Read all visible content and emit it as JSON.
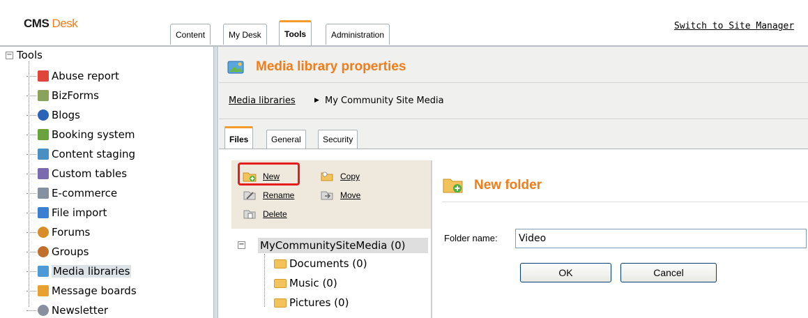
{
  "app": {
    "logo_part1": "CMS",
    "logo_part2": "Desk"
  },
  "header": {
    "tabs": [
      {
        "label": "Content",
        "selected": false
      },
      {
        "label": "My Desk",
        "selected": false
      },
      {
        "label": "Tools",
        "selected": true
      },
      {
        "label": "Administration",
        "selected": false
      }
    ],
    "switch_link": "Switch to Site Manager"
  },
  "sidebar": {
    "root": "Tools",
    "items": [
      {
        "label": "Abuse report",
        "icon": "abuse-report-icon",
        "color": "#e0443a"
      },
      {
        "label": "BizForms",
        "icon": "bizforms-icon",
        "color": "#8aa35a"
      },
      {
        "label": "Blogs",
        "icon": "blogs-icon",
        "color": "#2b63b8"
      },
      {
        "label": "Booking system",
        "icon": "booking-system-icon",
        "color": "#6aa33c"
      },
      {
        "label": "Content staging",
        "icon": "content-staging-icon",
        "color": "#4a8fc4"
      },
      {
        "label": "Custom tables",
        "icon": "custom-tables-icon",
        "color": "#7a6ab0"
      },
      {
        "label": "E-commerce",
        "icon": "ecommerce-icon",
        "color": "#8590a0"
      },
      {
        "label": "File import",
        "icon": "file-import-icon",
        "color": "#3a7fd0"
      },
      {
        "label": "Forums",
        "icon": "forums-icon",
        "color": "#d98c2a"
      },
      {
        "label": "Groups",
        "icon": "groups-icon",
        "color": "#c0702a"
      },
      {
        "label": "Media libraries",
        "icon": "media-libraries-icon",
        "color": "#4c9ad6",
        "selected": true
      },
      {
        "label": "Message boards",
        "icon": "message-boards-icon",
        "color": "#e8a030"
      },
      {
        "label": "Newsletter",
        "icon": "newsletter-icon",
        "color": "#8a8fa0"
      }
    ]
  },
  "main": {
    "title": "Media library properties",
    "breadcrumb": {
      "link": "Media libraries",
      "current": "My Community Site Media"
    },
    "tabs": [
      {
        "label": "Files",
        "selected": true
      },
      {
        "label": "General",
        "selected": false
      },
      {
        "label": "Security",
        "selected": false
      }
    ],
    "actions": {
      "new": "New",
      "copy": "Copy",
      "rename": "Rename",
      "move": "Move",
      "delete": "Delete"
    },
    "media_tree": {
      "root": "MyCommunitySiteMedia (0)",
      "folders": [
        "Documents (0)",
        "Music (0)",
        "Pictures (0)"
      ]
    },
    "new_folder": {
      "title": "New folder",
      "folder_name_label": "Folder name:",
      "folder_name_value": "Video",
      "ok_label": "OK",
      "cancel_label": "Cancel"
    }
  },
  "colors": {
    "accent_orange": "#f07d1a",
    "highlight_red": "#e51d1d",
    "panel_beige": "#efe8dc"
  }
}
